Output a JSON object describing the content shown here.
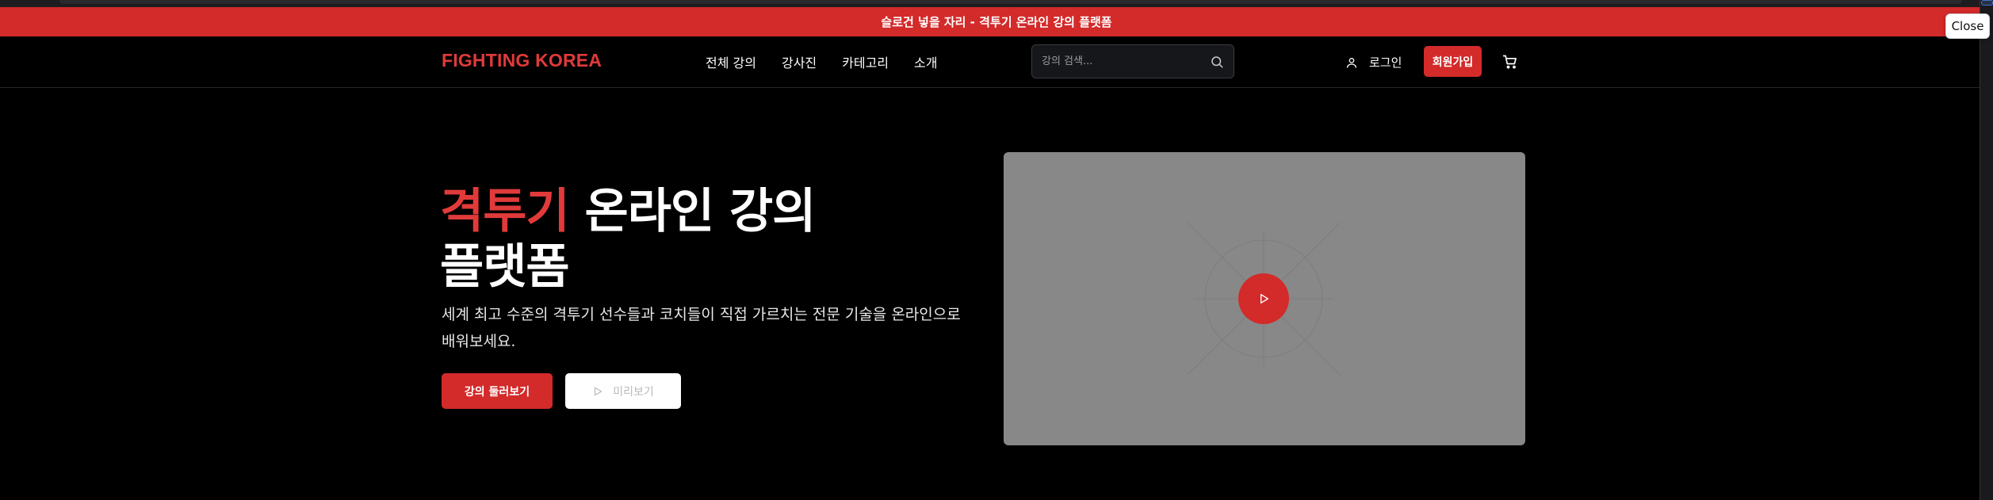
{
  "banner": {
    "text": "슬로건 넣을 자리 - 격투기 온라인 강의 플랫폼"
  },
  "tooltip": {
    "close_label": "Close"
  },
  "nav": {
    "logo": "FIGHTING KOREA",
    "links": [
      "전체 강의",
      "강사진",
      "카테고리",
      "소개"
    ],
    "search_placeholder": "강의 검색...",
    "login_label": "로그인",
    "signup_label": "회원가입"
  },
  "hero": {
    "title_accent": "격투기",
    "title_rest": " 온라인 강의",
    "title_line2": "플랫폼",
    "description_line1": "세계 최고 수준의 격투기 선수들과 코치들이 직접 가르치는 전문 기술을 온라인으로",
    "description_line2": "배워보세요.",
    "primary_button": "강의 둘러보기",
    "secondary_button": "미리보기"
  },
  "colors": {
    "accent": "#d32a2a",
    "background": "#000000",
    "video_placeholder": "#888888"
  },
  "icons": [
    "user-icon",
    "search-icon",
    "cart-icon",
    "play-icon"
  ]
}
